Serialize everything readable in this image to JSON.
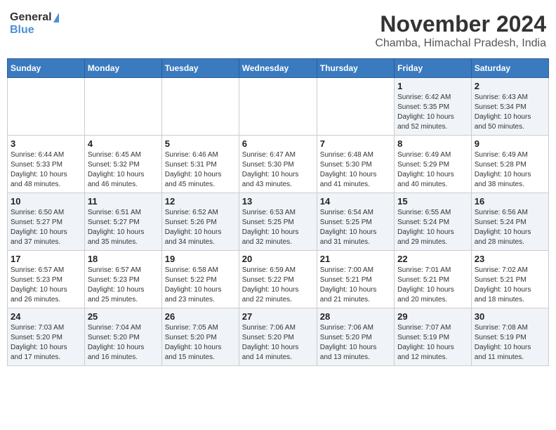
{
  "header": {
    "logo_general": "General",
    "logo_blue": "Blue",
    "month": "November 2024",
    "location": "Chamba, Himachal Pradesh, India"
  },
  "weekdays": [
    "Sunday",
    "Monday",
    "Tuesday",
    "Wednesday",
    "Thursday",
    "Friday",
    "Saturday"
  ],
  "weeks": [
    [
      {
        "day": "",
        "info": ""
      },
      {
        "day": "",
        "info": ""
      },
      {
        "day": "",
        "info": ""
      },
      {
        "day": "",
        "info": ""
      },
      {
        "day": "",
        "info": ""
      },
      {
        "day": "1",
        "info": "Sunrise: 6:42 AM\nSunset: 5:35 PM\nDaylight: 10 hours\nand 52 minutes."
      },
      {
        "day": "2",
        "info": "Sunrise: 6:43 AM\nSunset: 5:34 PM\nDaylight: 10 hours\nand 50 minutes."
      }
    ],
    [
      {
        "day": "3",
        "info": "Sunrise: 6:44 AM\nSunset: 5:33 PM\nDaylight: 10 hours\nand 48 minutes."
      },
      {
        "day": "4",
        "info": "Sunrise: 6:45 AM\nSunset: 5:32 PM\nDaylight: 10 hours\nand 46 minutes."
      },
      {
        "day": "5",
        "info": "Sunrise: 6:46 AM\nSunset: 5:31 PM\nDaylight: 10 hours\nand 45 minutes."
      },
      {
        "day": "6",
        "info": "Sunrise: 6:47 AM\nSunset: 5:30 PM\nDaylight: 10 hours\nand 43 minutes."
      },
      {
        "day": "7",
        "info": "Sunrise: 6:48 AM\nSunset: 5:30 PM\nDaylight: 10 hours\nand 41 minutes."
      },
      {
        "day": "8",
        "info": "Sunrise: 6:49 AM\nSunset: 5:29 PM\nDaylight: 10 hours\nand 40 minutes."
      },
      {
        "day": "9",
        "info": "Sunrise: 6:49 AM\nSunset: 5:28 PM\nDaylight: 10 hours\nand 38 minutes."
      }
    ],
    [
      {
        "day": "10",
        "info": "Sunrise: 6:50 AM\nSunset: 5:27 PM\nDaylight: 10 hours\nand 37 minutes."
      },
      {
        "day": "11",
        "info": "Sunrise: 6:51 AM\nSunset: 5:27 PM\nDaylight: 10 hours\nand 35 minutes."
      },
      {
        "day": "12",
        "info": "Sunrise: 6:52 AM\nSunset: 5:26 PM\nDaylight: 10 hours\nand 34 minutes."
      },
      {
        "day": "13",
        "info": "Sunrise: 6:53 AM\nSunset: 5:25 PM\nDaylight: 10 hours\nand 32 minutes."
      },
      {
        "day": "14",
        "info": "Sunrise: 6:54 AM\nSunset: 5:25 PM\nDaylight: 10 hours\nand 31 minutes."
      },
      {
        "day": "15",
        "info": "Sunrise: 6:55 AM\nSunset: 5:24 PM\nDaylight: 10 hours\nand 29 minutes."
      },
      {
        "day": "16",
        "info": "Sunrise: 6:56 AM\nSunset: 5:24 PM\nDaylight: 10 hours\nand 28 minutes."
      }
    ],
    [
      {
        "day": "17",
        "info": "Sunrise: 6:57 AM\nSunset: 5:23 PM\nDaylight: 10 hours\nand 26 minutes."
      },
      {
        "day": "18",
        "info": "Sunrise: 6:57 AM\nSunset: 5:23 PM\nDaylight: 10 hours\nand 25 minutes."
      },
      {
        "day": "19",
        "info": "Sunrise: 6:58 AM\nSunset: 5:22 PM\nDaylight: 10 hours\nand 23 minutes."
      },
      {
        "day": "20",
        "info": "Sunrise: 6:59 AM\nSunset: 5:22 PM\nDaylight: 10 hours\nand 22 minutes."
      },
      {
        "day": "21",
        "info": "Sunrise: 7:00 AM\nSunset: 5:21 PM\nDaylight: 10 hours\nand 21 minutes."
      },
      {
        "day": "22",
        "info": "Sunrise: 7:01 AM\nSunset: 5:21 PM\nDaylight: 10 hours\nand 20 minutes."
      },
      {
        "day": "23",
        "info": "Sunrise: 7:02 AM\nSunset: 5:21 PM\nDaylight: 10 hours\nand 18 minutes."
      }
    ],
    [
      {
        "day": "24",
        "info": "Sunrise: 7:03 AM\nSunset: 5:20 PM\nDaylight: 10 hours\nand 17 minutes."
      },
      {
        "day": "25",
        "info": "Sunrise: 7:04 AM\nSunset: 5:20 PM\nDaylight: 10 hours\nand 16 minutes."
      },
      {
        "day": "26",
        "info": "Sunrise: 7:05 AM\nSunset: 5:20 PM\nDaylight: 10 hours\nand 15 minutes."
      },
      {
        "day": "27",
        "info": "Sunrise: 7:06 AM\nSunset: 5:20 PM\nDaylight: 10 hours\nand 14 minutes."
      },
      {
        "day": "28",
        "info": "Sunrise: 7:06 AM\nSunset: 5:20 PM\nDaylight: 10 hours\nand 13 minutes."
      },
      {
        "day": "29",
        "info": "Sunrise: 7:07 AM\nSunset: 5:19 PM\nDaylight: 10 hours\nand 12 minutes."
      },
      {
        "day": "30",
        "info": "Sunrise: 7:08 AM\nSunset: 5:19 PM\nDaylight: 10 hours\nand 11 minutes."
      }
    ]
  ]
}
